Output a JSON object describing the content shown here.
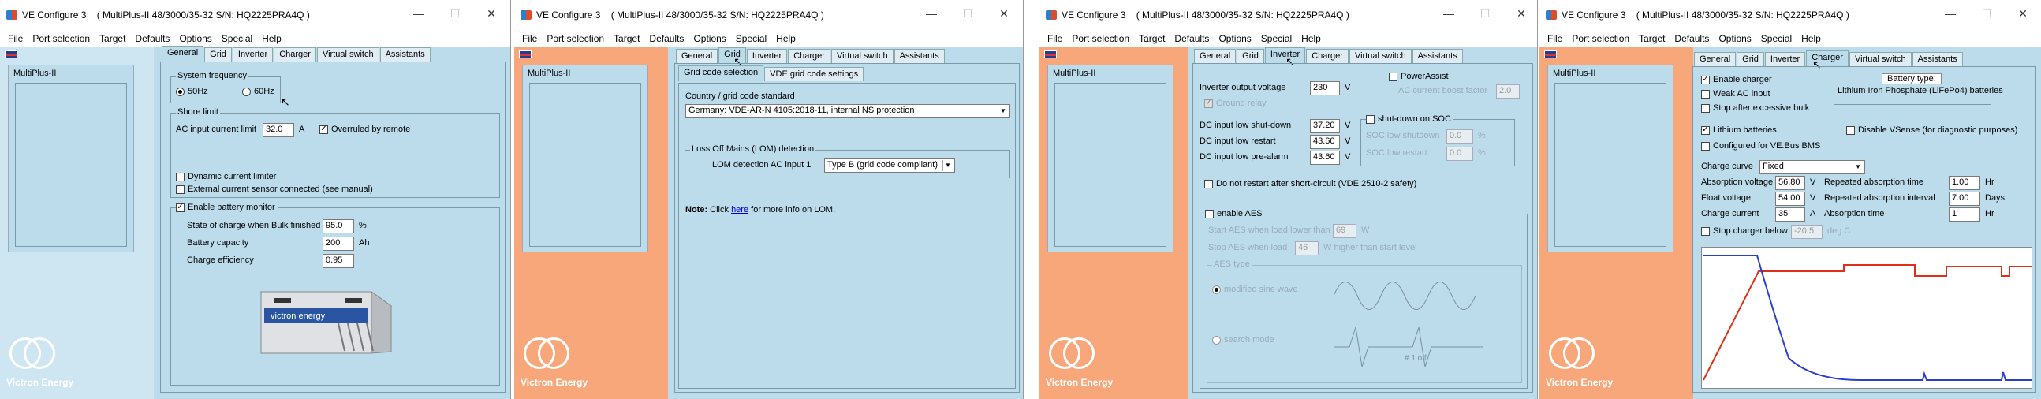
{
  "common": {
    "title": "VE Configure 3    ( MultiPlus-II 48/3000/35-32 S/N: HQ2225PRA4Q )",
    "menu": [
      "File",
      "Port selection",
      "Target",
      "Defaults",
      "Options",
      "Special",
      "Help"
    ],
    "unit_label": "MultiPlus-II",
    "logo_text": "Victron Energy",
    "tabs": [
      "General",
      "Grid",
      "Inverter",
      "Charger",
      "Virtual switch",
      "Assistants"
    ],
    "win_controls": {
      "minimize": "—",
      "maximize": "☐",
      "close": "✕"
    }
  },
  "general": {
    "system_frequency_label": "System frequency",
    "freq_50": "50Hz",
    "freq_60": "60Hz",
    "shore_limit_label": "Shore limit",
    "ac_input_current_limit_label": "AC input current limit",
    "ac_input_current_limit_value": "32.0",
    "ac_unit": "A",
    "overruled_by_remote": "Overruled by remote",
    "dynamic_current_limiter": "Dynamic current limiter",
    "external_current_sensor": "External current sensor connected (see manual)",
    "enable_battery_monitor": "Enable battery monitor",
    "soc_bulk_label": "State of charge when Bulk finished",
    "soc_bulk_value": "95.0",
    "soc_unit": "%",
    "battery_capacity_label": "Battery capacity",
    "battery_capacity_value": "200",
    "battery_capacity_unit": "Ah",
    "charge_efficiency_label": "Charge efficiency",
    "charge_efficiency_value": "0.95",
    "battery_brand": "victron energy"
  },
  "grid": {
    "subtabs": [
      "Grid code selection",
      "VDE grid code settings"
    ],
    "country_label": "Country / grid code standard",
    "country_value": "Germany:               VDE-AR-N 4105:2018-11, internal NS protection",
    "lom_group": "Loss Off Mains (LOM) detection",
    "lom_label": "LOM detection AC input 1",
    "lom_value": "Type B (grid code compliant)",
    "note_bold": "Note:",
    "note_pre": " Click ",
    "note_link": "here",
    "note_post": " for more info on LOM."
  },
  "inverter": {
    "output_voltage_label": "Inverter output voltage",
    "output_voltage_value": "230",
    "volt_unit": "V",
    "ground_relay": "Ground relay",
    "powerassist": "PowerAssist",
    "ac_boost_factor_label": "AC current boost factor",
    "ac_boost_factor_value": "2.0",
    "dc_low_shutdown_label": "DC input low shut-down",
    "dc_low_shutdown_value": "37.20",
    "dc_low_restart_label": "DC input low restart",
    "dc_low_restart_value": "43.60",
    "dc_low_prealarm_label": "DC input low pre-alarm",
    "dc_low_prealarm_value": "43.60",
    "shutdown_on_soc": "shut-down on SOC",
    "soc_shutdown_label": "SOC low shutdown",
    "soc_shutdown_value": "0.0",
    "soc_restart_label": "SOC low restart",
    "soc_restart_value": "0.0",
    "pct_unit": "%",
    "no_restart": "Do not restart after short-circuit (VDE 2510-2 safety)",
    "enable_aes": "enable AES",
    "aes_threshold_label": "Start AES when load lower than",
    "aes_threshold_value": "69",
    "aes_watt_unit": "W",
    "aes_stop_label": "Stop AES when load",
    "aes_stop_value": "46",
    "aes_stop_unit": "W higher than start level",
    "aes_type_label": "AES type",
    "aes_modified": "modified sine wave",
    "aes_search": "search mode",
    "aes_bulk_label": "# 1 off"
  },
  "charger": {
    "enable_charger": "Enable charger",
    "weak_ac_input": "Weak AC input",
    "stop_after_excessive_bulk": "Stop after excessive bulk",
    "battery_type_label": "Battery type:",
    "battery_type_value": "Lithium Iron Phosphate (LiFePo4) batteries",
    "lithium_batteries": "Lithium batteries",
    "disable_vsense": "Disable VSense (for diagnostic purposes)",
    "configured_bms": "Configured for VE.Bus BMS",
    "charge_curve_label": "Charge curve",
    "charge_curve_value": "Fixed",
    "absorption_voltage_label": "Absorption voltage",
    "absorption_voltage_value": "56.80",
    "float_voltage_label": "Float voltage",
    "float_voltage_value": "54.00",
    "charge_current_label": "Charge current",
    "charge_current_value": "35",
    "v_unit": "V",
    "a_unit": "A",
    "repeated_absorption_time_label": "Repeated absorption time",
    "repeated_absorption_time_value": "1.00",
    "repeated_absorption_interval_label": "Repeated absorption interval",
    "repeated_absorption_interval_value": "7.00",
    "absorption_time_label": "Absorption time",
    "absorption_time_value": "1",
    "hr_unit": "Hr",
    "days_unit": "Days",
    "stop_charger_below_label": "Stop charger below",
    "stop_charger_below_value": "-20.5",
    "deg_unit": "deg C",
    "line_colors": {
      "current": "#2a3fd0",
      "voltage": "#e0301a"
    }
  }
}
